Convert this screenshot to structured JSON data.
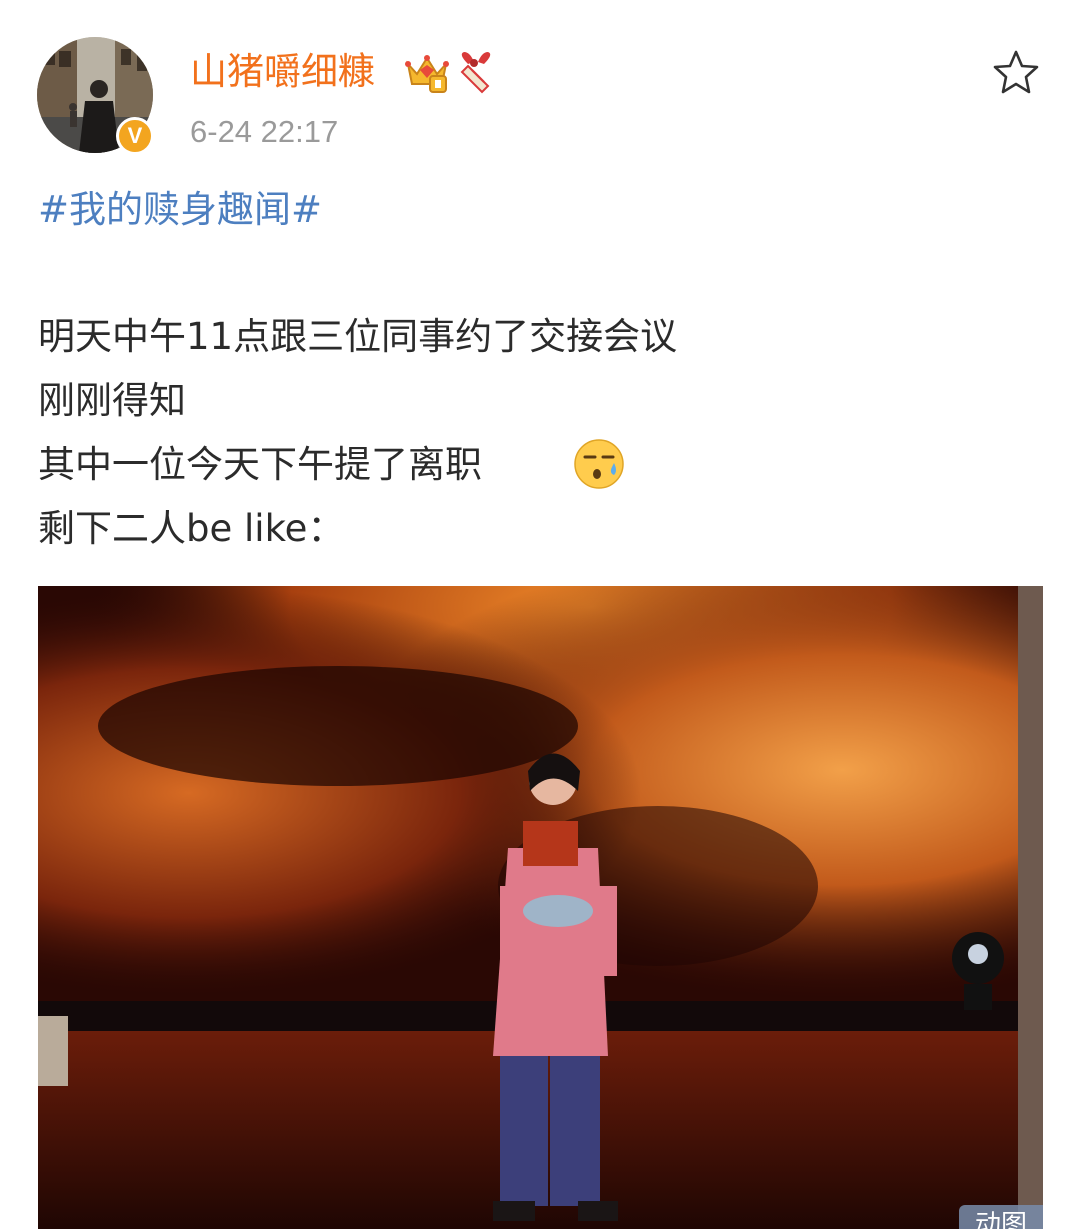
{
  "post": {
    "author": {
      "name": "山猪嚼细糠",
      "verified_mark": "V",
      "badge_icons": [
        "crown-icon",
        "gift-icon"
      ]
    },
    "timestamp": "6-24 22:17",
    "hashtag": "#我的赎身趣闻#",
    "lines": [
      "明天中午11点跟三位同事约了交接会议",
      "刚刚得知",
      "其中一位今天下午提了离职",
      "剩下二人be like："
    ],
    "inline_emoji": "sweat-face-emoji",
    "media": {
      "badge": "动图"
    }
  },
  "colors": {
    "username": "#f2711c",
    "hashtag": "#4d7fc0",
    "timestamp": "#9a9a9a",
    "verified": "#f3a51f"
  }
}
